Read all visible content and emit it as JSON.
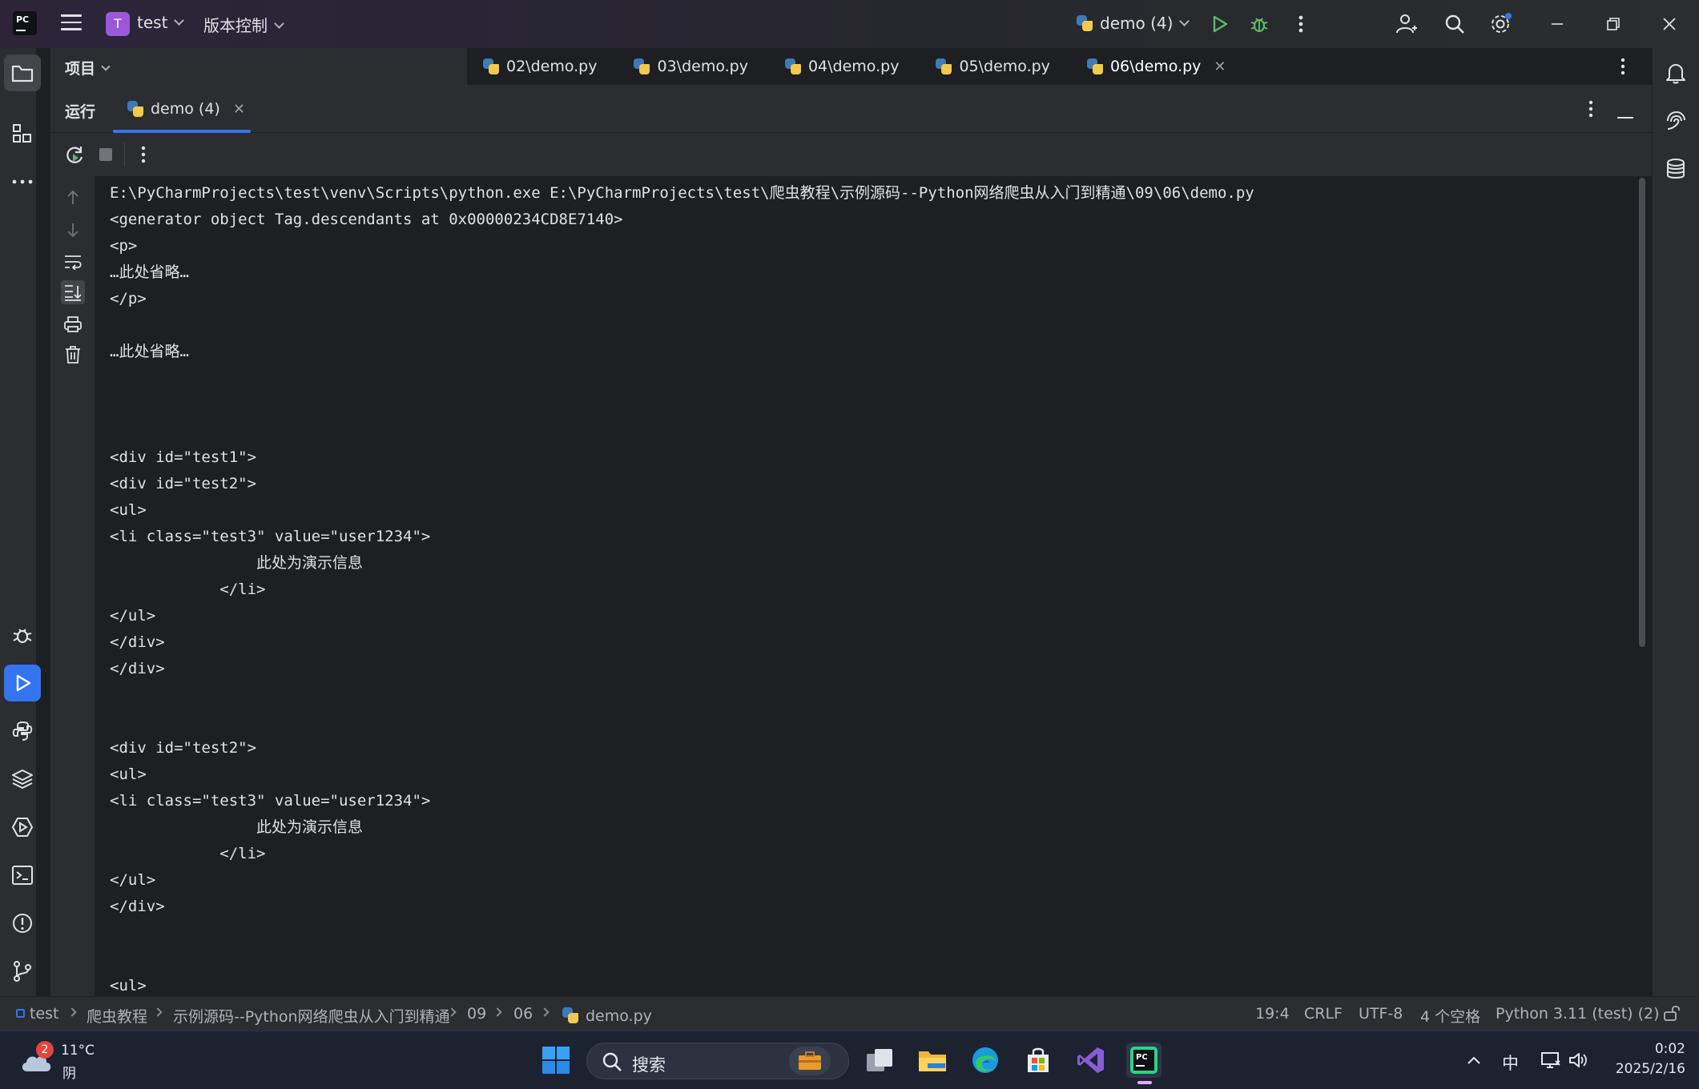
{
  "titlebar": {
    "project_badge": "T",
    "project_name": "test",
    "vcs_label": "版本控制",
    "run_config": "demo (4)"
  },
  "project_pane": {
    "label": "项目"
  },
  "editor_tabs": [
    {
      "label": "02\\demo.py"
    },
    {
      "label": "03\\demo.py"
    },
    {
      "label": "04\\demo.py"
    },
    {
      "label": "05\\demo.py"
    },
    {
      "label": "06\\demo.py",
      "active": true
    }
  ],
  "run_window": {
    "title": "运行",
    "tab_label": "demo (4)"
  },
  "console_lines": [
    "E:\\PyCharmProjects\\test\\venv\\Scripts\\python.exe E:\\PyCharmProjects\\test\\爬虫教程\\示例源码--Python网络爬虫从入门到精通\\09\\06\\demo.py",
    "<generator object Tag.descendants at 0x00000234CD8E7140>",
    "<p>",
    "…此处省略…",
    "</p>",
    "",
    "…此处省略…",
    "",
    "",
    "",
    "<div id=\"test1\">",
    "<div id=\"test2\">",
    "<ul>",
    "<li class=\"test3\" value=\"user1234\">",
    "                此处为演示信息",
    "            </li>",
    "</ul>",
    "</div>",
    "</div>",
    "",
    "",
    "<div id=\"test2\">",
    "<ul>",
    "<li class=\"test3\" value=\"user1234\">",
    "                此处为演示信息",
    "            </li>",
    "</ul>",
    "</div>",
    "",
    "",
    "<ul>"
  ],
  "statusbar": {
    "breadcrumbs": [
      "test",
      "爬虫教程",
      "示例源码--Python网络爬虫从入门到精通",
      "09",
      "06",
      "demo.py"
    ],
    "position": "19:4",
    "line_ending": "CRLF",
    "encoding": "UTF-8",
    "indent": "4 个空格",
    "interpreter": "Python 3.11 (test) (2)"
  },
  "taskbar": {
    "weather_temp": "11°C",
    "weather_desc": "阴",
    "weather_badge": "2",
    "search_label": "搜索",
    "ime": "中",
    "time": "0:02",
    "date": "2025/2/16"
  },
  "colors": {
    "accent": "#3574f0",
    "run_green": "#5fb865",
    "editor_bg": "#1e1f22",
    "panel_bg": "#2b2d30"
  }
}
